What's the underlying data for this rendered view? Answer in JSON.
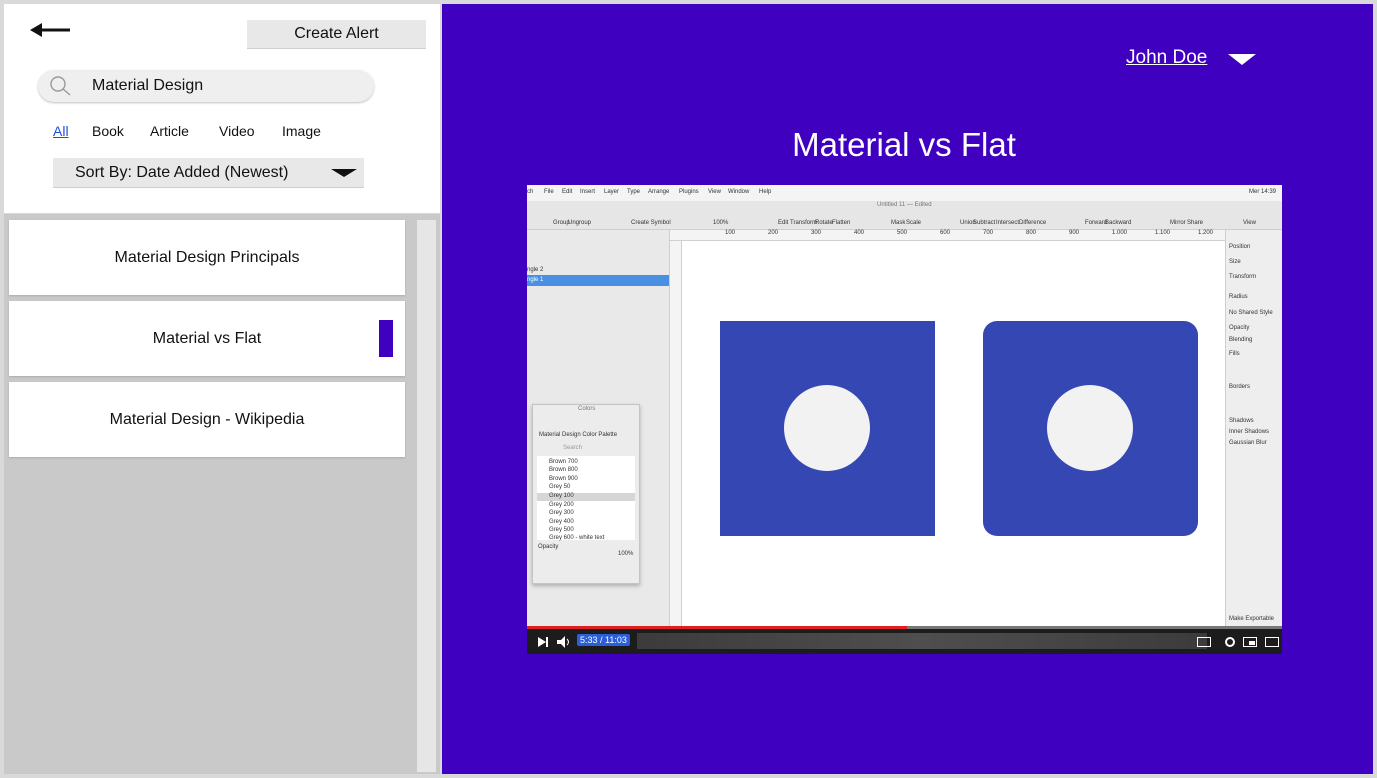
{
  "colors": {
    "accent": "#3f00c0",
    "shape": "#3547b3"
  },
  "header": {
    "create_alert": "Create Alert",
    "back_icon": "arrow-left-icon"
  },
  "search": {
    "value": "Material Design",
    "placeholder": ""
  },
  "filters": [
    {
      "label": "All",
      "active": true
    },
    {
      "label": "Book"
    },
    {
      "label": "Article"
    },
    {
      "label": "Video"
    },
    {
      "label": "Image"
    }
  ],
  "sort": {
    "label": "Sort By: Date Added (Newest)"
  },
  "results": [
    {
      "title": "Material Design Principals"
    },
    {
      "title": "Material vs Flat",
      "selected": true
    },
    {
      "title": "Material Design - Wikipedia"
    }
  ],
  "user": {
    "name": "John Doe"
  },
  "main": {
    "title": "Material vs Flat"
  },
  "video": {
    "menu": [
      "ch",
      "File",
      "Edit",
      "Insert",
      "Layer",
      "Type",
      "Arrange",
      "Plugins",
      "View",
      "Window",
      "Help"
    ],
    "status_time": "Mer 14:39",
    "doc_title": "Untitled 11 — Edited",
    "toolbar": [
      "Group",
      "Ungroup",
      "Create Symbol",
      "100%",
      "Edit",
      "Transform",
      "Rotate",
      "Flatten",
      "Mask",
      "Scale",
      "Union",
      "Subtract",
      "Intersect",
      "Difference",
      "Forward",
      "Backward",
      "Mirror",
      "Share",
      "View"
    ],
    "ruler": [
      "100",
      "200",
      "300",
      "400",
      "500",
      "600",
      "700",
      "800",
      "900",
      "1.000",
      "1.100",
      "1.200"
    ],
    "layers": [
      "ngle 2",
      "ngle 1"
    ],
    "colors_panel": {
      "title": "Colors",
      "palette": "Material Design Color Palette",
      "search": "Search",
      "items": [
        "Brown 700",
        "Brown 800",
        "Brown 900",
        "Grey 50",
        "Grey 100",
        "Grey 200",
        "Grey 300",
        "Grey 400",
        "Grey 500",
        "Grey 600 - white text"
      ],
      "opacity_label": "Opacity",
      "opacity_value": "100%"
    },
    "inspector": [
      "Position",
      "Size",
      "Transform",
      "Radius",
      "No Shared Style",
      "Opacity",
      "Blending",
      "Fills",
      "Borders",
      "Shadows",
      "Inner Shadows",
      "Gaussian Blur",
      "Make Exportable"
    ],
    "time": "5:33 / 11:03",
    "progress": 0.503
  }
}
